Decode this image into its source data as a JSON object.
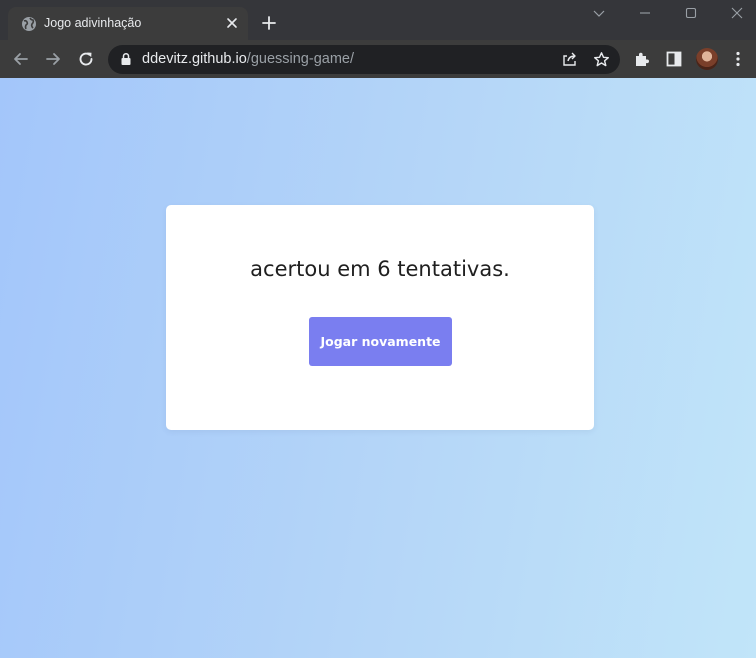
{
  "browser": {
    "tab": {
      "title": "Jogo adivinhação"
    },
    "address_bar": {
      "host": "ddevitz.github.io",
      "path": "/guessing-game/"
    }
  },
  "game": {
    "message": "acertou em 6 tentativas.",
    "play_again_label": "Jogar novamente"
  },
  "colors": {
    "page_gradient_start": "#a3c6fa",
    "page_gradient_end": "#c1e5f9",
    "button": "#7a7ef0",
    "card": "#ffffff"
  },
  "icons": [
    "globe-icon",
    "close-icon",
    "plus-icon",
    "chevron-down-icon",
    "minimize-icon",
    "maximize-icon",
    "back-icon",
    "forward-icon",
    "reload-icon",
    "lock-icon",
    "share-icon",
    "star-icon",
    "extensions-icon",
    "side-panel-icon",
    "menu-icon"
  ]
}
